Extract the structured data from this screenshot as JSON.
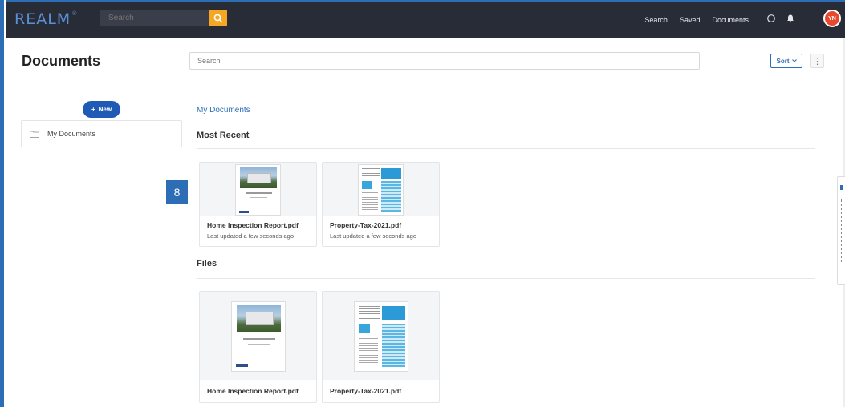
{
  "nav": {
    "logo": "REALM",
    "logo_mark": "®",
    "search_placeholder": "Search",
    "links": [
      "Search",
      "Saved",
      "Documents"
    ],
    "avatar_initials": "YN"
  },
  "header": {
    "title": "Documents",
    "search_placeholder": "Search",
    "sort_label": "Sort",
    "kebab": "⋮"
  },
  "sidebar": {
    "new_label": "New",
    "folders": [
      {
        "label": "My Documents"
      }
    ]
  },
  "badge": "8",
  "main": {
    "breadcrumb": "My Documents",
    "most_recent": {
      "title": "Most Recent",
      "items": [
        {
          "name": "Home Inspection Report.pdf",
          "updated": "Last updated a few seconds ago"
        },
        {
          "name": "Property-Tax-2021.pdf",
          "updated": "Last updated a few seconds ago"
        }
      ]
    },
    "files": {
      "title": "Files",
      "items": [
        {
          "name": "Home Inspection Report.pdf"
        },
        {
          "name": "Property-Tax-2021.pdf"
        }
      ]
    }
  },
  "colors": {
    "nav_bg": "#282c37",
    "accent": "#2d6db5",
    "search_btn": "#f5a623",
    "avatar": "#e8492e",
    "new_btn": "#1f5bb5"
  }
}
